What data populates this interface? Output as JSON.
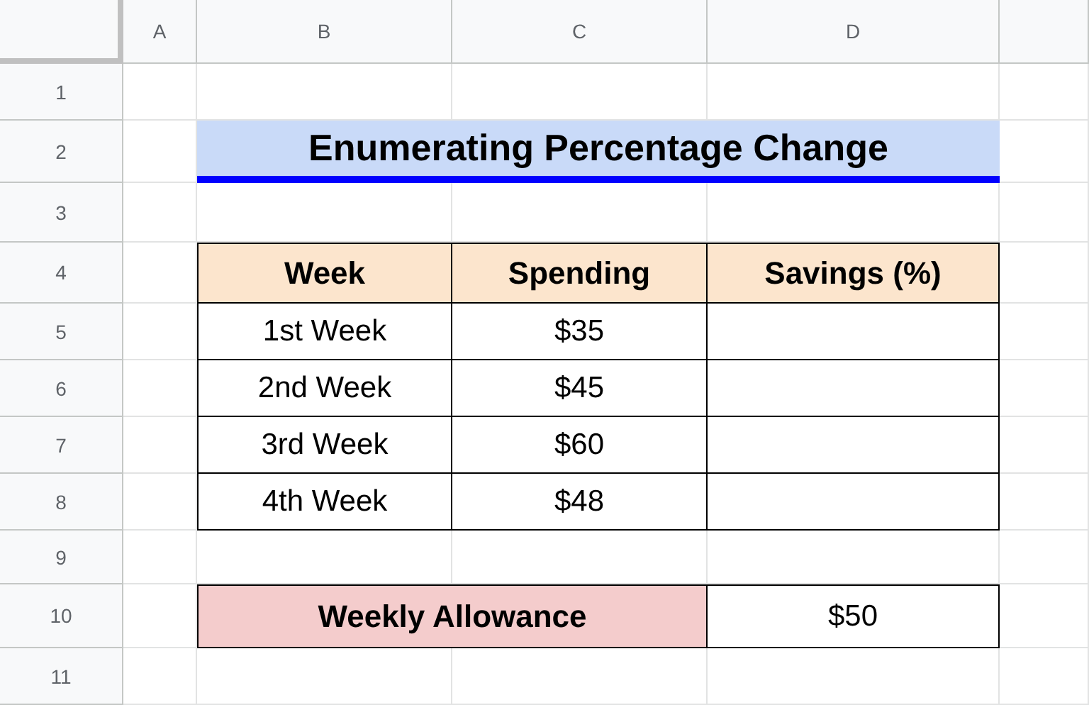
{
  "sheet": {
    "columns": [
      "A",
      "B",
      "C",
      "D"
    ],
    "rows": [
      "1",
      "2",
      "3",
      "4",
      "5",
      "6",
      "7",
      "8",
      "9",
      "10",
      "11"
    ]
  },
  "title": "Enumerating Percentage Change",
  "table": {
    "columns": [
      "Week",
      "Spending",
      "Savings (%)"
    ],
    "rows": [
      {
        "week": "1st Week",
        "spending": "$35"
      },
      {
        "week": "2nd Week",
        "spending": "$45"
      },
      {
        "week": "3rd Week",
        "spending": "$60"
      },
      {
        "week": "4th Week",
        "spending": "$48"
      }
    ]
  },
  "allowance": {
    "label": "Weekly Allowance",
    "value": "$50"
  }
}
